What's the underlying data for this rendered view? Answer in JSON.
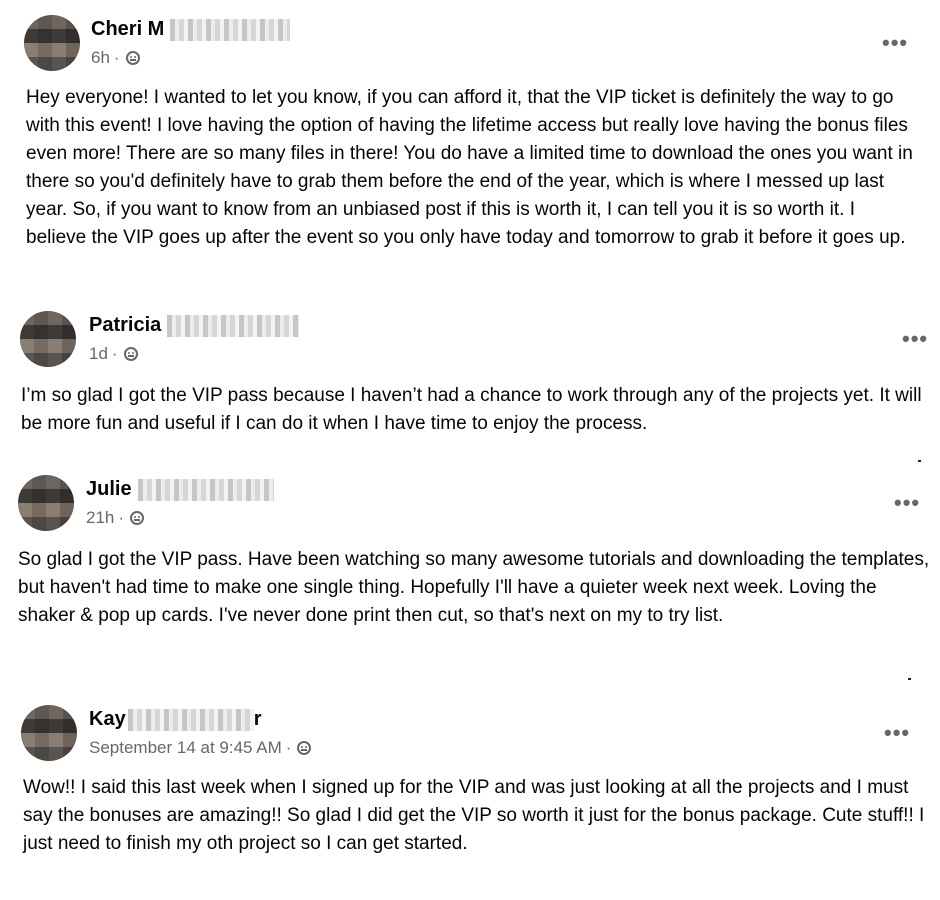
{
  "posts": [
    {
      "author": "Cheri M",
      "time": "6h",
      "separator": "·",
      "text": "Hey everyone! I wanted to let you know, if you can afford it, that the VIP ticket is definitely the way to go with this event! I love having the option of having the lifetime access but really love having the bonus files even more! There are so many files in there! You do have a limited time to download the ones you want in there so you'd definitely have to grab them before the end of the year, which is where I messed up last year. So, if you want to know from an unbiased post if this is worth it, I can tell you it is so worth it. I believe the VIP goes up after the event so you only have today and tomorrow to grab it before it goes up.",
      "more_label": "•••"
    },
    {
      "author": "Patricia",
      "time": "1d",
      "separator": "·",
      "text": "I’m so glad I got the VIP pass because I haven’t had a chance to work through any of the projects yet. It will be more fun and useful if I can do it when I have time to enjoy the process.",
      "more_label": "•••"
    },
    {
      "author": "Julie",
      "time": "21h",
      "separator": "·",
      "text": "So glad I got the VIP pass. Have been watching so many awesome tutorials and downloading the templates, but haven't had time to make one single thing. Hopefully I'll have a quieter week next week. Loving the shaker & pop up cards. I've never done print then cut, so that's next on my to try list.",
      "more_label": "•••"
    },
    {
      "author": "Kay",
      "author_suffix": "r",
      "time": "September 14 at 9:45 AM",
      "separator": "·",
      "text": "Wow!! I said this last week when I signed up for the VIP and was just looking at all the projects and I must say the bonuses are amazing!! So glad I did get the VIP so worth it just for the bonus package. Cute stuff!! I just need to finish my oth project so I can get started.",
      "more_label": "•••"
    }
  ],
  "icons": {
    "privacy": "globe-icon",
    "more": "more-options-icon"
  }
}
